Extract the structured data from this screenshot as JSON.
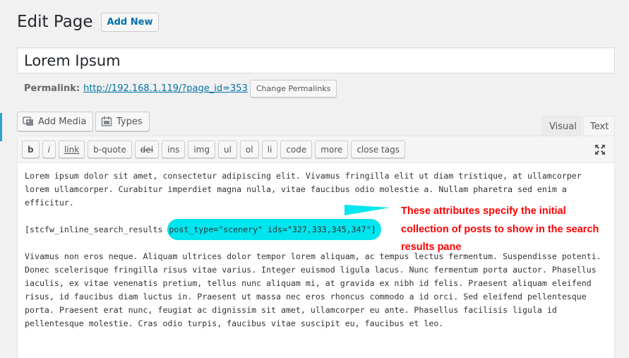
{
  "header": {
    "title": "Edit Page",
    "add_new_label": "Add New"
  },
  "post_title": "Lorem Ipsum",
  "permalink": {
    "label": "Permalink:",
    "url": "http://192.168.1.119/?page_id=353",
    "change_label": "Change Permalinks"
  },
  "media_buttons": {
    "add_media": "Add Media",
    "types": "Types"
  },
  "editor_tabs": {
    "visual": "Visual",
    "text": "Text"
  },
  "quicktags": [
    "b",
    "i",
    "link",
    "b-quote",
    "del",
    "ins",
    "img",
    "ul",
    "ol",
    "li",
    "code",
    "more",
    "close tags"
  ],
  "content": {
    "paragraph1": "Lorem ipsum dolor sit amet, consectetur adipiscing elit. Vivamus fringilla elit ut diam tristique, at ullamcorper lorem ullamcorper. Curabitur imperdiet magna nulla, vitae faucibus odio molestie a. Nullam pharetra sed enim a efficitur.",
    "shortcode_start": "[stcfw_inline_search_results ",
    "shortcode_attrs": "post_type=\"scenery\" ids=\"327,333,345,347\"]",
    "paragraph2": "Vivamus non eros neque. Aliquam ultrices dolor tempor lorem aliquam, ac tempus lectus fermentum. Suspendisse potenti. Donec scelerisque fringilla risus vitae varius. Integer euismod ligula lacus. Nunc fermentum porta auctor. Phasellus iaculis, ex vitae venenatis pretium, tellus nunc aliquam mi, at gravida ex nibh id felis. Praesent aliquam eleifend risus, id faucibus diam luctus in. Praesent ut massa nec eros rhoncus commodo a id orci. Sed eleifend pellentesque porta. Praesent erat nunc, feugiat ac dignissim sit amet, ullamcorper eu ante. Phasellus facilisis ligula id pellentesque molestie. Cras odio turpis, faucibus vitae suscipit eu, faucibus et leo."
  },
  "annotation": {
    "text": "These attributes specify the initial collection of posts to show in the search results pane",
    "color": "#ff0000",
    "highlight_color": "#00e5ee"
  },
  "icons": {
    "add_media": "media-icon",
    "types": "types-icon",
    "fullscreen": "fullscreen-icon"
  }
}
